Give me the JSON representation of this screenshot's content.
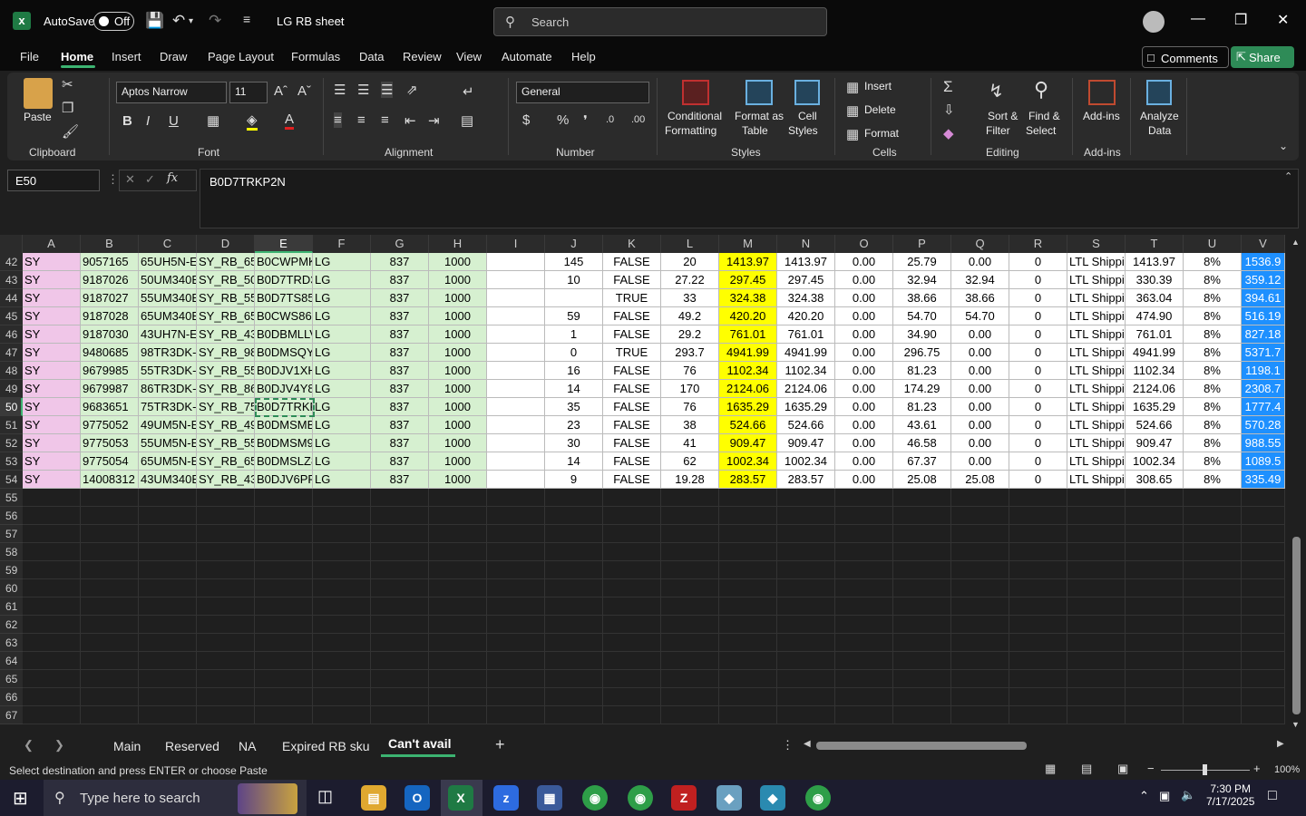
{
  "titlebar": {
    "autosave_label": "AutoSave",
    "autosave_state": "Off",
    "doc_title": "LG RB sheet",
    "search_placeholder": "Search"
  },
  "menu": {
    "tabs": [
      "File",
      "Home",
      "Insert",
      "Draw",
      "Page Layout",
      "Formulas",
      "Data",
      "Review",
      "View",
      "Automate",
      "Help"
    ],
    "comments": "Comments",
    "share": "Share"
  },
  "ribbon": {
    "clipboard": {
      "paste": "Paste",
      "label": "Clipboard"
    },
    "font": {
      "family": "Aptos Narrow",
      "size": "11",
      "label": "Font"
    },
    "alignment": {
      "label": "Alignment"
    },
    "number": {
      "format": "General",
      "label": "Number"
    },
    "styles": {
      "conditional": "Conditional",
      "conditional2": "Formatting",
      "format_as": "Format as",
      "format_as2": "Table",
      "cell": "Cell",
      "cell2": "Styles",
      "label": "Styles"
    },
    "cells": {
      "insert": "Insert",
      "delete": "Delete",
      "format": "Format",
      "label": "Cells"
    },
    "editing": {
      "sort": "Sort &",
      "sort2": "Filter",
      "find": "Find &",
      "find2": "Select",
      "label": "Editing"
    },
    "addins": {
      "addins": "Add-ins",
      "label": "Add-ins",
      "analyze": "Analyze",
      "analyze2": "Data"
    }
  },
  "formula_bar": {
    "name_box": "E50",
    "formula": "B0D7TRKP2N"
  },
  "columns": [
    "A",
    "B",
    "C",
    "D",
    "E",
    "F",
    "G",
    "H",
    "I",
    "J",
    "K",
    "L",
    "M",
    "N",
    "O",
    "P",
    "Q",
    "R",
    "S",
    "T",
    "U",
    "V"
  ],
  "rows": [
    {
      "n": "42",
      "A": "SY",
      "B": "9057165",
      "C": "65UH5N-E",
      "D": "SY_RB_65U",
      "E": "B0CWPMK",
      "F": "LG",
      "G": "837",
      "H": "1000",
      "J": "145",
      "K": "FALSE",
      "L": "20",
      "M": "1413.97",
      "N": "1413.97",
      "O": "0.00",
      "P": "25.79",
      "Q": "0.00",
      "R": "0",
      "S": "LTL Shippi",
      "T": "1413.97",
      "U": "8%",
      "V": "1536.9"
    },
    {
      "n": "43",
      "A": "SY",
      "B": "9187026",
      "C": "50UM340E",
      "D": "SY_RB_50U",
      "E": "B0D7TRD3",
      "F": "LG",
      "G": "837",
      "H": "1000",
      "J": "10",
      "K": "FALSE",
      "L": "27.22",
      "M": "297.45",
      "N": "297.45",
      "O": "0.00",
      "P": "32.94",
      "Q": "32.94",
      "R": "0",
      "S": "LTL Shippi",
      "T": "330.39",
      "U": "8%",
      "V": "359.12"
    },
    {
      "n": "44",
      "A": "SY",
      "B": "9187027",
      "C": "55UM340E",
      "D": "SY_RB_55U",
      "E": "B0D7TS85",
      "F": "LG",
      "G": "837",
      "H": "1000",
      "J": "",
      "K": "TRUE",
      "L": "33",
      "M": "324.38",
      "N": "324.38",
      "O": "0.00",
      "P": "38.66",
      "Q": "38.66",
      "R": "0",
      "S": "LTL Shippi",
      "T": "363.04",
      "U": "8%",
      "V": "394.61"
    },
    {
      "n": "45",
      "A": "SY",
      "B": "9187028",
      "C": "65UM340E",
      "D": "SY_RB_65U",
      "E": "B0CWS86L",
      "F": "LG",
      "G": "837",
      "H": "1000",
      "J": "59",
      "K": "FALSE",
      "L": "49.2",
      "M": "420.20",
      "N": "420.20",
      "O": "0.00",
      "P": "54.70",
      "Q": "54.70",
      "R": "0",
      "S": "LTL Shippi",
      "T": "474.90",
      "U": "8%",
      "V": "516.19"
    },
    {
      "n": "46",
      "A": "SY",
      "B": "9187030",
      "C": "43UH7N-E",
      "D": "SY_RB_43U",
      "E": "B0DBMLLV",
      "F": "LG",
      "G": "837",
      "H": "1000",
      "J": "1",
      "K": "FALSE",
      "L": "29.2",
      "M": "761.01",
      "N": "761.01",
      "O": "0.00",
      "P": "34.90",
      "Q": "0.00",
      "R": "0",
      "S": "LTL Shippi",
      "T": "761.01",
      "U": "8%",
      "V": "827.18"
    },
    {
      "n": "47",
      "A": "SY",
      "B": "9480685",
      "C": "98TR3DK-I",
      "D": "SY_RB_98T",
      "E": "B0DMSQY",
      "F": "LG",
      "G": "837",
      "H": "1000",
      "J": "0",
      "K": "TRUE",
      "L": "293.7",
      "M": "4941.99",
      "N": "4941.99",
      "O": "0.00",
      "P": "296.75",
      "Q": "0.00",
      "R": "0",
      "S": "LTL Shippi",
      "T": "4941.99",
      "U": "8%",
      "V": "5371.7"
    },
    {
      "n": "48",
      "A": "SY",
      "B": "9679985",
      "C": "55TR3DK-I",
      "D": "SY_RB_55T",
      "E": "B0DJV1XH",
      "F": "LG",
      "G": "837",
      "H": "1000",
      "J": "16",
      "K": "FALSE",
      "L": "76",
      "M": "1102.34",
      "N": "1102.34",
      "O": "0.00",
      "P": "81.23",
      "Q": "0.00",
      "R": "0",
      "S": "LTL Shippi",
      "T": "1102.34",
      "U": "8%",
      "V": "1198.1"
    },
    {
      "n": "49",
      "A": "SY",
      "B": "9679987",
      "C": "86TR3DK-I",
      "D": "SY_RB_86T",
      "E": "B0DJV4Y8",
      "F": "LG",
      "G": "837",
      "H": "1000",
      "J": "14",
      "K": "FALSE",
      "L": "170",
      "M": "2124.06",
      "N": "2124.06",
      "O": "0.00",
      "P": "174.29",
      "Q": "0.00",
      "R": "0",
      "S": "LTL Shippi",
      "T": "2124.06",
      "U": "8%",
      "V": "2308.7"
    },
    {
      "n": "50",
      "A": "SY",
      "B": "9683651",
      "C": "75TR3DK-I",
      "D": "SY_RB_75T",
      "E": "B0D7TRKP",
      "F": "LG",
      "G": "837",
      "H": "1000",
      "J": "35",
      "K": "FALSE",
      "L": "76",
      "M": "1635.29",
      "N": "1635.29",
      "O": "0.00",
      "P": "81.23",
      "Q": "0.00",
      "R": "0",
      "S": "LTL Shippi",
      "T": "1635.29",
      "U": "8%",
      "V": "1777.4"
    },
    {
      "n": "51",
      "A": "SY",
      "B": "9775052",
      "C": "49UM5N-E",
      "D": "SY_RB_49U",
      "E": "B0DMSMB",
      "F": "LG",
      "G": "837",
      "H": "1000",
      "J": "23",
      "K": "FALSE",
      "L": "38",
      "M": "524.66",
      "N": "524.66",
      "O": "0.00",
      "P": "43.61",
      "Q": "0.00",
      "R": "0",
      "S": "LTL Shippi",
      "T": "524.66",
      "U": "8%",
      "V": "570.28"
    },
    {
      "n": "52",
      "A": "SY",
      "B": "9775053",
      "C": "55UM5N-E",
      "D": "SY_RB_55U",
      "E": "B0DMSM9",
      "F": "LG",
      "G": "837",
      "H": "1000",
      "J": "30",
      "K": "FALSE",
      "L": "41",
      "M": "909.47",
      "N": "909.47",
      "O": "0.00",
      "P": "46.58",
      "Q": "0.00",
      "R": "0",
      "S": "LTL Shippi",
      "T": "909.47",
      "U": "8%",
      "V": "988.55"
    },
    {
      "n": "53",
      "A": "SY",
      "B": "9775054",
      "C": "65UM5N-E",
      "D": "SY_RB_65U",
      "E": "B0DMSLZ8",
      "F": "LG",
      "G": "837",
      "H": "1000",
      "J": "14",
      "K": "FALSE",
      "L": "62",
      "M": "1002.34",
      "N": "1002.34",
      "O": "0.00",
      "P": "67.37",
      "Q": "0.00",
      "R": "0",
      "S": "LTL Shippi",
      "T": "1002.34",
      "U": "8%",
      "V": "1089.5"
    },
    {
      "n": "54",
      "A": "SY",
      "B": "14008312",
      "C": "43UM340E",
      "D": "SY_RB_43U",
      "E": "B0DJV6PR",
      "F": "LG",
      "G": "837",
      "H": "1000",
      "J": "9",
      "K": "FALSE",
      "L": "19.28",
      "M": "283.57",
      "N": "283.57",
      "O": "0.00",
      "P": "25.08",
      "Q": "25.08",
      "R": "0",
      "S": "LTL Shippi",
      "T": "308.65",
      "U": "8%",
      "V": "335.49"
    }
  ],
  "empty_rows": [
    "55",
    "56",
    "57",
    "58",
    "59",
    "60",
    "61",
    "62",
    "63",
    "64",
    "65",
    "66",
    "67"
  ],
  "selected_row": "50",
  "selected_col": "E",
  "colors": {
    "pink": "#f0c6e8",
    "green": "#d6f0d0",
    "yellow": "#ffff00",
    "blue": "#1e90ff",
    "accent": "#3cb371"
  },
  "sheet_tabs": [
    "Main",
    "Reserved",
    "NA",
    "Expired RB sku",
    "Can't avail"
  ],
  "active_sheet": "Can't avail",
  "status": {
    "message": "Select destination and press ENTER or choose Paste",
    "zoom": "100%"
  },
  "taskbar": {
    "search_placeholder": "Type here to search",
    "time": "7:30 PM",
    "date": "7/17/2025"
  }
}
